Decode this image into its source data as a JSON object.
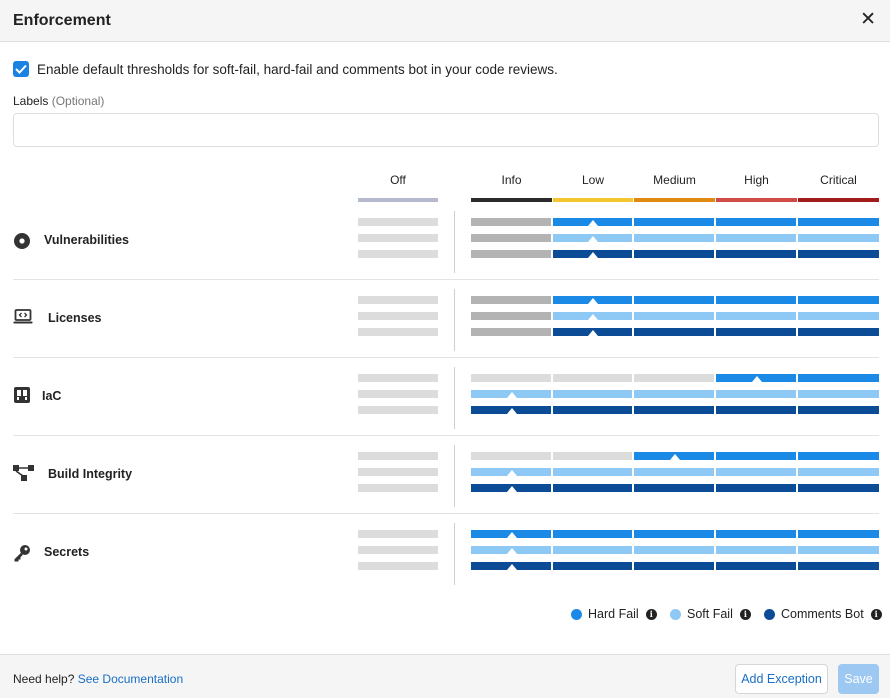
{
  "header": {
    "title": "Enforcement",
    "close_label": "✕"
  },
  "defaults": {
    "checked": true,
    "label": "Enable default thresholds for soft-fail, hard-fail and comments bot in your code reviews."
  },
  "labels_field": {
    "label": "Labels",
    "optional": "(Optional)",
    "value": "",
    "placeholder": ""
  },
  "severity_columns": [
    {
      "label": "Off",
      "color": "#b5b9d0"
    },
    {
      "label": "Info",
      "color": "#2b2b2b"
    },
    {
      "label": "Low",
      "color": "#f2c62f"
    },
    {
      "label": "Medium",
      "color": "#e08a12"
    },
    {
      "label": "High",
      "color": "#d04a47"
    },
    {
      "label": "Critical",
      "color": "#a31c1c"
    }
  ],
  "colors": {
    "hard_fail": "#1a8ae6",
    "soft_fail": "#8ec9f5",
    "comments_bot": "#0c4c96",
    "inactive": "#b3b3b3",
    "off_track": "#dcdcdc",
    "accent": "#1a82e2"
  },
  "policies": [
    {
      "name": "Vulnerabilities",
      "icon": "vulnerability-target-icon",
      "thresholds": {
        "hard_fail": "Low",
        "soft_fail": "Low",
        "comments_bot": "Low"
      },
      "unset_style": "dark"
    },
    {
      "name": "Licenses",
      "icon": "license-laptop-icon",
      "thresholds": {
        "hard_fail": "Low",
        "soft_fail": "Low",
        "comments_bot": "Low"
      },
      "unset_style": "dark"
    },
    {
      "name": "IaC",
      "icon": "iac-icon",
      "thresholds": {
        "hard_fail": "High",
        "soft_fail": "Info",
        "comments_bot": "Info"
      },
      "unset_style": "light"
    },
    {
      "name": "Build Integrity",
      "icon": "build-integrity-icon",
      "thresholds": {
        "hard_fail": "Medium",
        "soft_fail": "Info",
        "comments_bot": "Info"
      },
      "unset_style": "light"
    },
    {
      "name": "Secrets",
      "icon": "key-icon",
      "thresholds": {
        "hard_fail": "Info",
        "soft_fail": "Info",
        "comments_bot": "Info"
      },
      "unset_style": "light"
    }
  ],
  "legend": [
    {
      "label": "Hard Fail",
      "color": "#1a8ae6"
    },
    {
      "label": "Soft Fail",
      "color": "#8ec9f5"
    },
    {
      "label": "Comments Bot",
      "color": "#0c4c96"
    }
  ],
  "footer": {
    "help_text": "Need help?",
    "help_link": "See Documentation",
    "add_exception": "Add Exception",
    "save": "Save"
  }
}
